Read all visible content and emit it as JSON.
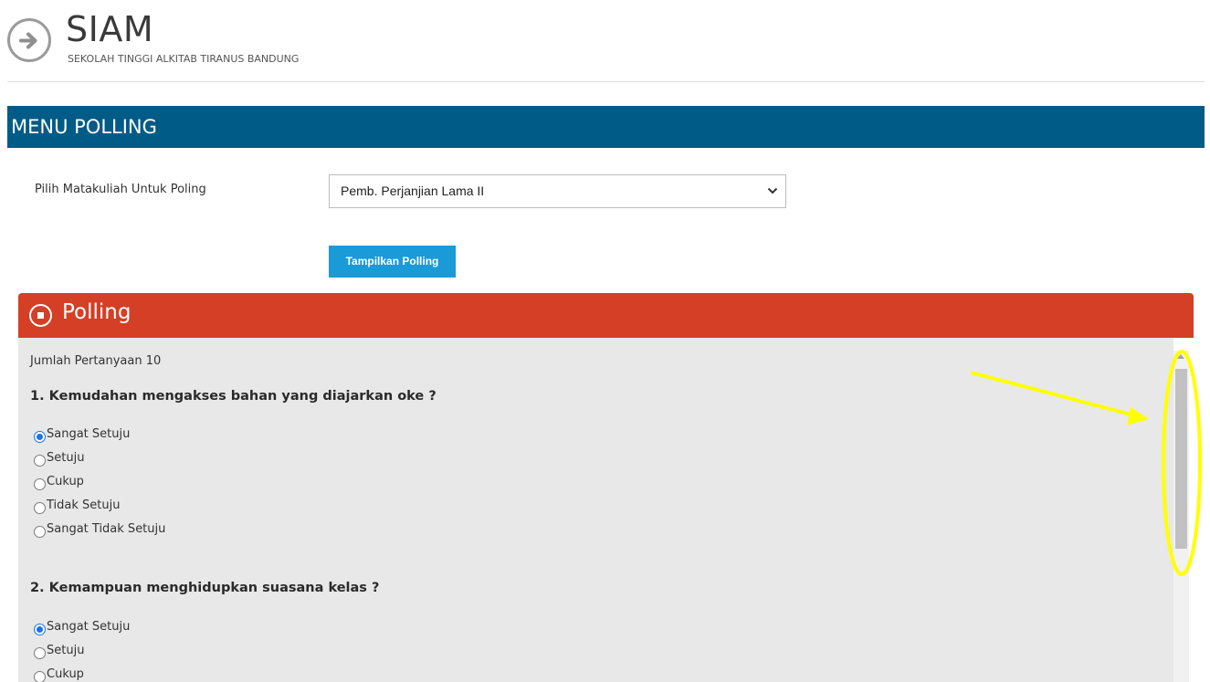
{
  "header": {
    "title": "SIAM",
    "subtitle": "SEKOLAH TINGGI ALKITAB TIRANUS BANDUNG"
  },
  "menu": {
    "title": "MENU POLLING"
  },
  "form": {
    "label": "Pilih Matakuliah Untuk Poling",
    "selected_course": "Pemb. Perjanjian Lama II",
    "show_button": "Tampilkan Polling"
  },
  "polling": {
    "title": "Polling",
    "count_text": "Jumlah Pertanyaan 10",
    "questions": [
      {
        "text": "1. Kemudahan mengakses bahan yang diajarkan oke ?",
        "options": [
          "Sangat Setuju",
          "Setuju",
          "Cukup",
          "Tidak Setuju",
          "Sangat Tidak Setuju"
        ],
        "selected": "Sangat Setuju"
      },
      {
        "text": "2. Kemampuan menghidupkan suasana kelas ?",
        "options": [
          "Sangat Setuju",
          "Setuju",
          "Cukup"
        ],
        "selected": "Sangat Setuju"
      }
    ]
  },
  "colors": {
    "menu_bar": "#005b86",
    "poll_header": "#d43f25",
    "button": "#1a9ad6",
    "annotation": "#ffff00"
  },
  "icons": {
    "logo": "arrow-right-circle-icon",
    "poll": "list-circle-icon",
    "select": "chevron-down-icon"
  }
}
